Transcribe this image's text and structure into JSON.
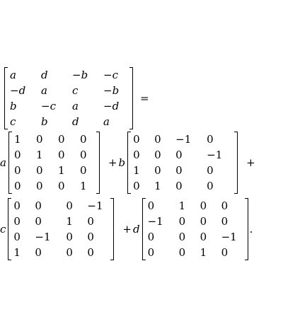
{
  "equation": {
    "equals": "=",
    "plus": "+",
    "period": ".",
    "lhs": [
      [
        "a",
        "d",
        "−b",
        "−c"
      ],
      [
        "−d",
        "a",
        "c",
        "−b"
      ],
      [
        "b",
        "−c",
        "a",
        "−d"
      ],
      [
        "c",
        "b",
        "d",
        "a"
      ]
    ],
    "terms": [
      {
        "coef": "a",
        "matrix": [
          [
            "1",
            "0",
            "0",
            "0"
          ],
          [
            "0",
            "1",
            "0",
            "0"
          ],
          [
            "0",
            "0",
            "1",
            "0"
          ],
          [
            "0",
            "0",
            "0",
            "1"
          ]
        ]
      },
      {
        "coef": "b",
        "matrix": [
          [
            "0",
            "0",
            "−1",
            "0"
          ],
          [
            "0",
            "0",
            "0",
            "−1"
          ],
          [
            "1",
            "0",
            "0",
            "0"
          ],
          [
            "0",
            "1",
            "0",
            "0"
          ]
        ]
      },
      {
        "coef": "c",
        "matrix": [
          [
            "0",
            "0",
            "0",
            "−1"
          ],
          [
            "0",
            "0",
            "1",
            "0"
          ],
          [
            "0",
            "−1",
            "0",
            "0"
          ],
          [
            "1",
            "0",
            "0",
            "0"
          ]
        ]
      },
      {
        "coef": "d",
        "matrix": [
          [
            "0",
            "1",
            "0",
            "0"
          ],
          [
            "−1",
            "0",
            "0",
            "0"
          ],
          [
            "0",
            "0",
            "0",
            "−1"
          ],
          [
            "0",
            "0",
            "1",
            "0"
          ]
        ]
      }
    ]
  }
}
